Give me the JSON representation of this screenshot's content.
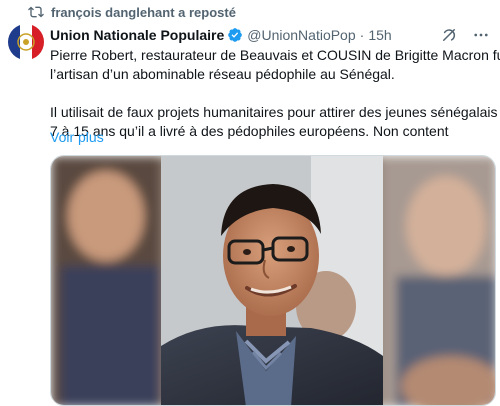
{
  "repost": {
    "text": "françois danglehant a reposté",
    "icon": "repost-icon"
  },
  "author": {
    "display_name": "Union Nationale Populaire",
    "handle": "@UnionNatioPop",
    "separator": "·",
    "time": "15h",
    "verified": true,
    "avatar_colors": [
      "#1f3b8c",
      "#ffffff",
      "#d61f26"
    ]
  },
  "tweet": {
    "line1": "Pierre Robert, restaurateur de Beauvais et COUSIN de Brigitte Macron fut",
    "line2": "l’artisan d’un abominable réseau pédophile au Sénégal.",
    "line3": "Il utilisait de faux projets humanitaires pour attirer des jeunes sénégalais de",
    "line4": "7 à 15 ans qu’il a livré à des pédophiles européens. Non content",
    "show_more": "Voir plus"
  },
  "colors": {
    "link": "#1d9bf0",
    "secondary_text": "#536471",
    "verified": "#1d9bf0"
  }
}
